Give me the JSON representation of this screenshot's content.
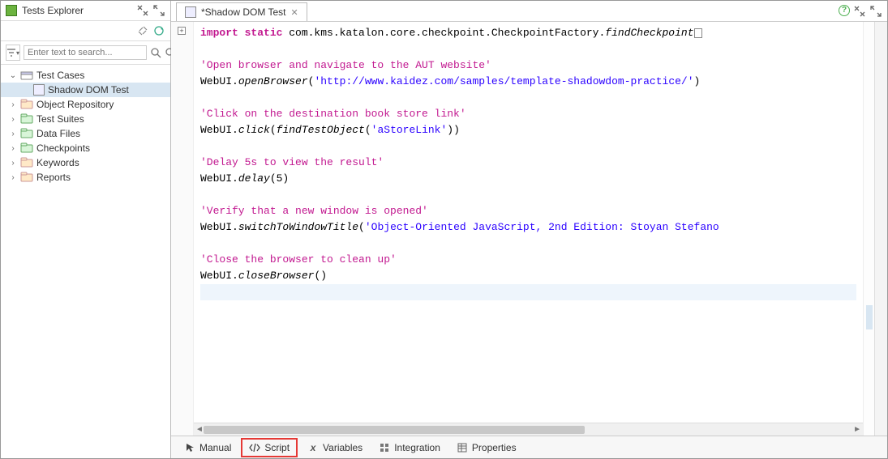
{
  "sidebar": {
    "title": "Tests Explorer",
    "search_placeholder": "Enter text to search...",
    "items": [
      {
        "label": "Test Cases",
        "expanded": true,
        "icon": "testcases"
      },
      {
        "label": "Shadow DOM Test",
        "child": true,
        "selected": true,
        "icon": "testcase"
      },
      {
        "label": "Object Repository",
        "icon": "repo"
      },
      {
        "label": "Test Suites",
        "icon": "suites"
      },
      {
        "label": "Data Files",
        "icon": "data"
      },
      {
        "label": "Checkpoints",
        "icon": "checkpoints"
      },
      {
        "label": "Keywords",
        "icon": "keywords"
      },
      {
        "label": "Reports",
        "icon": "reports"
      }
    ]
  },
  "editor": {
    "tab_title": "*Shadow DOM Test",
    "code": {
      "import_kw": "import static",
      "import_pkg": " com.kms.katalon.core.checkpoint.CheckpointFactory.",
      "import_member": "findCheckpoint",
      "c1": "'Open browser and navigate to the AUT website'",
      "l1a": "WebUI.",
      "l1b": "openBrowser",
      "l1c": "(",
      "l1d": "'http://www.kaidez.com/samples/template-shadowdom-practice/'",
      "l1e": ")",
      "c2": "'Click on the destination book store link'",
      "l2a": "WebUI.",
      "l2b": "click",
      "l2c": "(",
      "l2d": "findTestObject",
      "l2e": "(",
      "l2f": "'aStoreLink'",
      "l2g": "))",
      "c3": "'Delay 5s to view the result'",
      "l3a": "WebUI.",
      "l3b": "delay",
      "l3c": "(5)",
      "c4": "'Verify that a new window is opened'",
      "l4a": "WebUI.",
      "l4b": "switchToWindowTitle",
      "l4c": "(",
      "l4d": "'Object-Oriented JavaScript, 2nd Edition: Stoyan Stefano",
      "c5": "'Close the browser to clean up'",
      "l5a": "WebUI.",
      "l5b": "closeBrowser",
      "l5c": "()"
    }
  },
  "bottom_tabs": [
    {
      "label": "Manual",
      "icon": "cursor"
    },
    {
      "label": "Script",
      "icon": "code",
      "highlighted": true
    },
    {
      "label": "Variables",
      "icon": "x"
    },
    {
      "label": "Integration",
      "icon": "integration"
    },
    {
      "label": "Properties",
      "icon": "grid"
    }
  ]
}
